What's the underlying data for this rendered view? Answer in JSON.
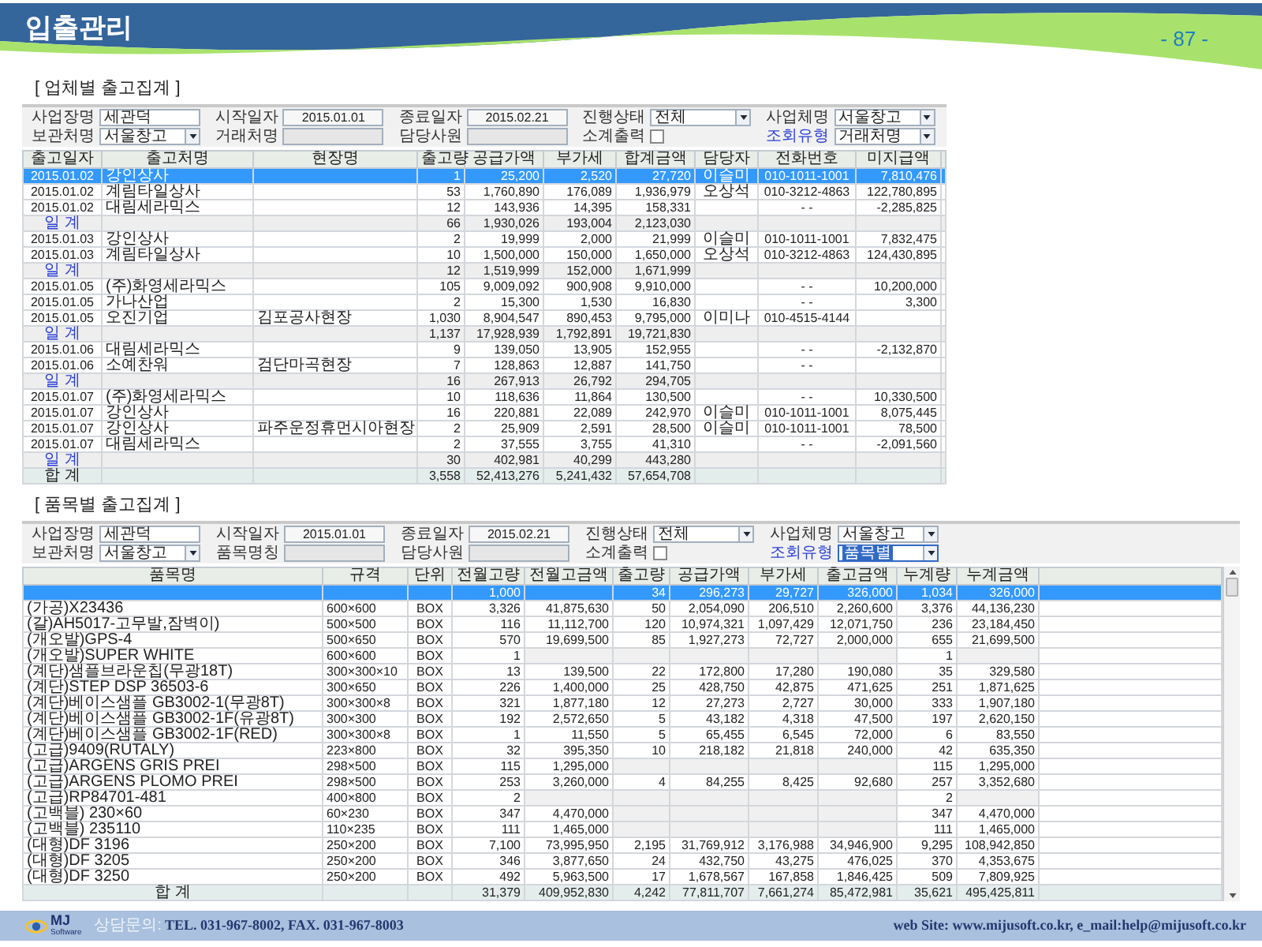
{
  "header": {
    "title": "입출관리",
    "page_number": "- 87 -"
  },
  "sections": [
    {
      "title": "[ 업체별 출고집계 ]",
      "filters": [
        [
          {
            "kind": "text",
            "label": "사업장명",
            "value": "세관덕",
            "accent": false,
            "disabled": false,
            "focused": false
          },
          {
            "kind": "date",
            "label": "시작일자",
            "value": "2015.01.01",
            "accent": false,
            "disabled": false,
            "focused": false
          },
          {
            "kind": "date",
            "label": "종료일자",
            "value": "2015.02.21",
            "accent": false,
            "disabled": false,
            "focused": false
          },
          {
            "kind": "select",
            "label": "진행상태",
            "value": "전체",
            "accent": false,
            "disabled": false,
            "focused": false
          },
          {
            "kind": "select",
            "label": "사업체명",
            "value": "서울창고",
            "accent": false,
            "disabled": false,
            "focused": false
          }
        ],
        [
          {
            "kind": "select",
            "label": "보관처명",
            "value": "서울창고",
            "accent": false,
            "disabled": false,
            "focused": false
          },
          {
            "kind": "text",
            "label": "거래처명",
            "accent": false,
            "disabled": true,
            "focused": false
          },
          {
            "kind": "text",
            "label": "담당사원",
            "accent": false,
            "disabled": true,
            "focused": false
          },
          {
            "kind": "checkbox",
            "label": "소계출력",
            "accent": false,
            "checked": false
          },
          {
            "kind": "select",
            "label": "조회유형",
            "value": "거래처명",
            "accent": true,
            "disabled": false,
            "focused": false
          }
        ]
      ],
      "table": {
        "columns": [
          "출고일자",
          "출고처명",
          "현장명",
          "출고량",
          "공급가액",
          "부가세",
          "합계금액",
          "담당자",
          "전화번호",
          "미지급액"
        ],
        "rows": [
          {
            "kind": "item",
            "selected": true,
            "cells": [
              "2015.01.02",
              "강인상사",
              null,
              "1",
              "25,200",
              "2,520",
              "27,720",
              "이슬미",
              "010-1011-1001",
              "7,810,476"
            ]
          },
          {
            "kind": "item",
            "selected": false,
            "cells": [
              "2015.01.02",
              "계림타일상사",
              null,
              "53",
              "1,760,890",
              "176,089",
              "1,936,979",
              "오상석",
              "010-3212-4863",
              "122,780,895"
            ]
          },
          {
            "kind": "item",
            "selected": false,
            "cells": [
              "2015.01.02",
              "대림세라믹스",
              null,
              "12",
              "143,936",
              "14,395",
              "158,331",
              null,
              "- -",
              "-2,285,825"
            ]
          },
          {
            "kind": "subtotal",
            "selected": false,
            "cells": [
              "일 계",
              null,
              null,
              "66",
              "1,930,026",
              "193,004",
              "2,123,030",
              null,
              null,
              null
            ]
          },
          {
            "kind": "item",
            "selected": false,
            "cells": [
              "2015.01.03",
              "강인상사",
              null,
              "2",
              "19,999",
              "2,000",
              "21,999",
              "이슬미",
              "010-1011-1001",
              "7,832,475"
            ]
          },
          {
            "kind": "item",
            "selected": false,
            "cells": [
              "2015.01.03",
              "계림타일상사",
              null,
              "10",
              "1,500,000",
              "150,000",
              "1,650,000",
              "오상석",
              "010-3212-4863",
              "124,430,895"
            ]
          },
          {
            "kind": "subtotal",
            "selected": false,
            "cells": [
              "일 계",
              null,
              null,
              "12",
              "1,519,999",
              "152,000",
              "1,671,999",
              null,
              null,
              null
            ]
          },
          {
            "kind": "item",
            "selected": false,
            "cells": [
              "2015.01.05",
              "(주)화영세라믹스",
              null,
              "105",
              "9,009,092",
              "900,908",
              "9,910,000",
              null,
              "- -",
              "10,200,000"
            ]
          },
          {
            "kind": "item",
            "selected": false,
            "cells": [
              "2015.01.05",
              "가나산업",
              null,
              "2",
              "15,300",
              "1,530",
              "16,830",
              null,
              "- -",
              "3,300"
            ]
          },
          {
            "kind": "item",
            "selected": false,
            "cells": [
              "2015.01.05",
              "오진기업",
              "김포공사현장",
              "1,030",
              "8,904,547",
              "890,453",
              "9,795,000",
              "이미나",
              "010-4515-4144",
              null
            ]
          },
          {
            "kind": "subtotal",
            "selected": false,
            "cells": [
              "일 계",
              null,
              null,
              "1,137",
              "17,928,939",
              "1,792,891",
              "19,721,830",
              null,
              null,
              null
            ]
          },
          {
            "kind": "item",
            "selected": false,
            "cells": [
              "2015.01.06",
              "대림세라믹스",
              null,
              "9",
              "139,050",
              "13,905",
              "152,955",
              null,
              "- -",
              "-2,132,870"
            ]
          },
          {
            "kind": "item",
            "selected": false,
            "cells": [
              "2015.01.06",
              "소예찬워",
              "검단마곡현장",
              "7",
              "128,863",
              "12,887",
              "141,750",
              null,
              "- -",
              null
            ]
          },
          {
            "kind": "subtotal",
            "selected": false,
            "cells": [
              "일 계",
              null,
              null,
              "16",
              "267,913",
              "26,792",
              "294,705",
              null,
              null,
              null
            ]
          },
          {
            "kind": "item",
            "selected": false,
            "cells": [
              "2015.01.07",
              "(주)화영세라믹스",
              null,
              "10",
              "118,636",
              "11,864",
              "130,500",
              null,
              "- -",
              "10,330,500"
            ]
          },
          {
            "kind": "item",
            "selected": false,
            "cells": [
              "2015.01.07",
              "강인상사",
              null,
              "16",
              "220,881",
              "22,089",
              "242,970",
              "이슬미",
              "010-1011-1001",
              "8,075,445"
            ]
          },
          {
            "kind": "item",
            "selected": false,
            "cells": [
              "2015.01.07",
              "강인상사",
              "파주운정휴먼시아현장",
              "2",
              "25,909",
              "2,591",
              "28,500",
              "이슬미",
              "010-1011-1001",
              "78,500"
            ]
          },
          {
            "kind": "item",
            "selected": false,
            "cells": [
              "2015.01.07",
              "대림세라믹스",
              null,
              "2",
              "37,555",
              "3,755",
              "41,310",
              null,
              "- -",
              "-2,091,560"
            ]
          },
          {
            "kind": "subtotal",
            "selected": false,
            "cells": [
              "일 계",
              null,
              null,
              "30",
              "402,981",
              "40,299",
              "443,280",
              null,
              null,
              null
            ]
          },
          {
            "kind": "total",
            "selected": false,
            "cells": [
              "합 계",
              null,
              null,
              "3,558",
              "52,413,276",
              "5,241,432",
              "57,654,708",
              null,
              null,
              null
            ]
          }
        ]
      }
    },
    {
      "title": "[ 품목별 출고집계 ]",
      "filters": [
        [
          {
            "kind": "text",
            "label": "사업장명",
            "value": "세관덕",
            "accent": false,
            "disabled": false,
            "focused": false
          },
          {
            "kind": "date",
            "label": "시작일자",
            "value": "2015.01.01",
            "accent": false,
            "disabled": false,
            "focused": false
          },
          {
            "kind": "date",
            "label": "종료일자",
            "value": "2015.02.21",
            "accent": false,
            "disabled": false,
            "focused": false
          },
          {
            "kind": "select",
            "label": "진행상태",
            "value": "전체",
            "accent": false,
            "disabled": false,
            "focused": false
          },
          {
            "kind": "select",
            "label": "사업체명",
            "value": "서울창고",
            "accent": false,
            "disabled": false,
            "focused": false
          }
        ],
        [
          {
            "kind": "select",
            "label": "보관처명",
            "value": "서울창고",
            "accent": false,
            "disabled": false,
            "focused": false
          },
          {
            "kind": "text",
            "label": "품목명칭",
            "accent": false,
            "disabled": true,
            "focused": false
          },
          {
            "kind": "text",
            "label": "담당사원",
            "accent": false,
            "disabled": true,
            "focused": false
          },
          {
            "kind": "checkbox",
            "label": "소계출력",
            "accent": false,
            "checked": false
          },
          {
            "kind": "select",
            "label": "조회유형",
            "value": "품목별",
            "accent": true,
            "disabled": false,
            "focused": true
          }
        ]
      ],
      "table": {
        "columns": [
          "품목명",
          "규격",
          "단위",
          "전월고량",
          "전월고금액",
          "출고량",
          "공급가액",
          "부가세",
          "출고금액",
          "누계량",
          "누계금액"
        ],
        "rows": [
          {
            "kind": "item",
            "selected": true,
            "cells": [
              null,
              null,
              null,
              "1,000",
              null,
              "34",
              "296,273",
              "29,727",
              "326,000",
              "1,034",
              "326,000"
            ]
          },
          {
            "kind": "item",
            "selected": false,
            "cells": [
              "(가공)X23436",
              "600×600",
              "BOX",
              "3,326",
              "41,875,630",
              "50",
              "2,054,090",
              "206,510",
              "2,260,600",
              "3,376",
              "44,136,230"
            ]
          },
          {
            "kind": "item",
            "selected": false,
            "cells": [
              "(갈)AH5017-고무발,잠벽이)",
              "500×500",
              "BOX",
              "116",
              "11,112,700",
              "120",
              "10,974,321",
              "1,097,429",
              "12,071,750",
              "236",
              "23,184,450"
            ]
          },
          {
            "kind": "item",
            "selected": false,
            "cells": [
              "(개오발)GPS-4",
              "500×650",
              "BOX",
              "570",
              "19,699,500",
              "85",
              "1,927,273",
              "72,727",
              "2,000,000",
              "655",
              "21,699,500"
            ]
          },
          {
            "kind": "item",
            "selected": false,
            "cells": [
              "(개오발)SUPER WHITE",
              "600×600",
              "BOX",
              "1",
              null,
              null,
              null,
              null,
              null,
              "1",
              null
            ]
          },
          {
            "kind": "item",
            "selected": false,
            "cells": [
              "(계단)샘플브라운칩(무광18T)",
              "300×300×10",
              "BOX",
              "13",
              "139,500",
              "22",
              "172,800",
              "17,280",
              "190,080",
              "35",
              "329,580"
            ]
          },
          {
            "kind": "item",
            "selected": false,
            "cells": [
              "(계단)STEP DSP 36503-6",
              "300×650",
              "BOX",
              "226",
              "1,400,000",
              "25",
              "428,750",
              "42,875",
              "471,625",
              "251",
              "1,871,625"
            ]
          },
          {
            "kind": "item",
            "selected": false,
            "cells": [
              "(계단)베이스샘플 GB3002-1(무광8T)",
              "300×300×8",
              "BOX",
              "321",
              "1,877,180",
              "12",
              "27,273",
              "2,727",
              "30,000",
              "333",
              "1,907,180"
            ]
          },
          {
            "kind": "item",
            "selected": false,
            "cells": [
              "(계단)베이스샘플 GB3002-1F(유광8T)",
              "300×300",
              "BOX",
              "192",
              "2,572,650",
              "5",
              "43,182",
              "4,318",
              "47,500",
              "197",
              "2,620,150"
            ]
          },
          {
            "kind": "item",
            "selected": false,
            "cells": [
              "(계단)베이스샘플 GB3002-1F(RED)",
              "300×300×8",
              "BOX",
              "1",
              "11,550",
              "5",
              "65,455",
              "6,545",
              "72,000",
              "6",
              "83,550"
            ]
          },
          {
            "kind": "item",
            "selected": false,
            "cells": [
              "(고급)9409(RUTALY)",
              "223×800",
              "BOX",
              "32",
              "395,350",
              "10",
              "218,182",
              "21,818",
              "240,000",
              "42",
              "635,350"
            ]
          },
          {
            "kind": "item",
            "selected": false,
            "cells": [
              "(고급)ARGENS GRIS PREI",
              "298×500",
              "BOX",
              "115",
              "1,295,000",
              null,
              null,
              null,
              null,
              "115",
              "1,295,000"
            ]
          },
          {
            "kind": "item",
            "selected": false,
            "cells": [
              "(고급)ARGENS PLOMO PREI",
              "298×500",
              "BOX",
              "253",
              "3,260,000",
              "4",
              "84,255",
              "8,425",
              "92,680",
              "257",
              "3,352,680"
            ]
          },
          {
            "kind": "item",
            "selected": false,
            "cells": [
              "(고급)RP84701-481",
              "400×800",
              "BOX",
              "2",
              null,
              null,
              null,
              null,
              null,
              "2",
              null
            ]
          },
          {
            "kind": "item",
            "selected": false,
            "cells": [
              "(고백블) 230×60",
              "60×230",
              "BOX",
              "347",
              "4,470,000",
              null,
              null,
              null,
              null,
              "347",
              "4,470,000"
            ]
          },
          {
            "kind": "item",
            "selected": false,
            "cells": [
              "(고백블) 235110",
              "110×235",
              "BOX",
              "111",
              "1,465,000",
              null,
              null,
              null,
              null,
              "111",
              "1,465,000"
            ]
          },
          {
            "kind": "item",
            "selected": false,
            "cells": [
              "(대형)DF 3196",
              "250×200",
              "BOX",
              "7,100",
              "73,995,950",
              "2,195",
              "31,769,912",
              "3,176,988",
              "34,946,900",
              "9,295",
              "108,942,850"
            ]
          },
          {
            "kind": "item",
            "selected": false,
            "cells": [
              "(대형)DF 3205",
              "250×200",
              "BOX",
              "346",
              "3,877,650",
              "24",
              "432,750",
              "43,275",
              "476,025",
              "370",
              "4,353,675"
            ]
          },
          {
            "kind": "item",
            "selected": false,
            "cells": [
              "(대형)DF 3250",
              "250×200",
              "BOX",
              "492",
              "5,963,500",
              "17",
              "1,678,567",
              "167,858",
              "1,846,425",
              "509",
              "7,809,925"
            ]
          },
          {
            "kind": "total",
            "selected": false,
            "cells": [
              "합 계",
              null,
              null,
              "31,379",
              "409,952,830",
              "4,242",
              "77,811,707",
              "7,661,274",
              "85,472,981",
              "35,621",
              "495,425,811"
            ]
          }
        ]
      }
    }
  ],
  "footer": {
    "logo": {
      "mark": "MJ",
      "subtext": "Software"
    },
    "contact_label": "상담문의:",
    "contact": "TEL. 031-967-8002, FAX. 031-967-8003",
    "web": "web Site: www.mijusoft.co.kr, e_mail:help@mijusoft.co.kr"
  }
}
